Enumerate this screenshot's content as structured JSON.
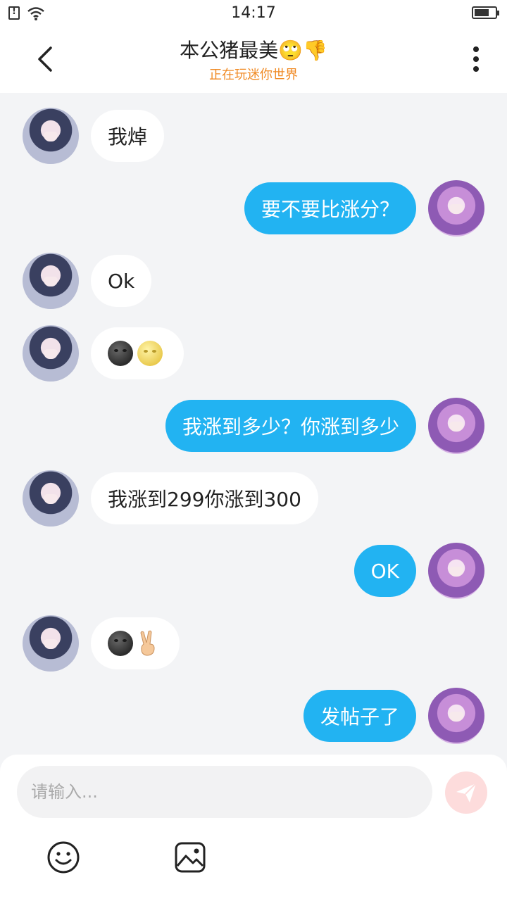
{
  "status_bar": {
    "time": "14:17"
  },
  "header": {
    "title": "本公猪最美🙄👎",
    "subtitle": "正在玩迷你世界"
  },
  "messages": [
    {
      "side": "left",
      "text": "我焯"
    },
    {
      "side": "right",
      "text": "要不要比涨分？"
    },
    {
      "side": "left",
      "text": "Ok"
    },
    {
      "side": "left",
      "emojis": [
        "new-moon-face",
        "full-moon-face"
      ]
    },
    {
      "side": "right",
      "text": "我涨到多少？你涨到多少"
    },
    {
      "side": "left",
      "text": "我涨到299你涨到300"
    },
    {
      "side": "right",
      "text": "OK"
    },
    {
      "side": "left",
      "emojis": [
        "new-moon-face",
        "victory-hand"
      ]
    },
    {
      "side": "right",
      "text": "发帖子了"
    }
  ],
  "composer": {
    "placeholder": "请输入..."
  },
  "colors": {
    "accent": "#22b3f2",
    "subtitle": "#f08a24",
    "send_button": "#fddcdc"
  }
}
